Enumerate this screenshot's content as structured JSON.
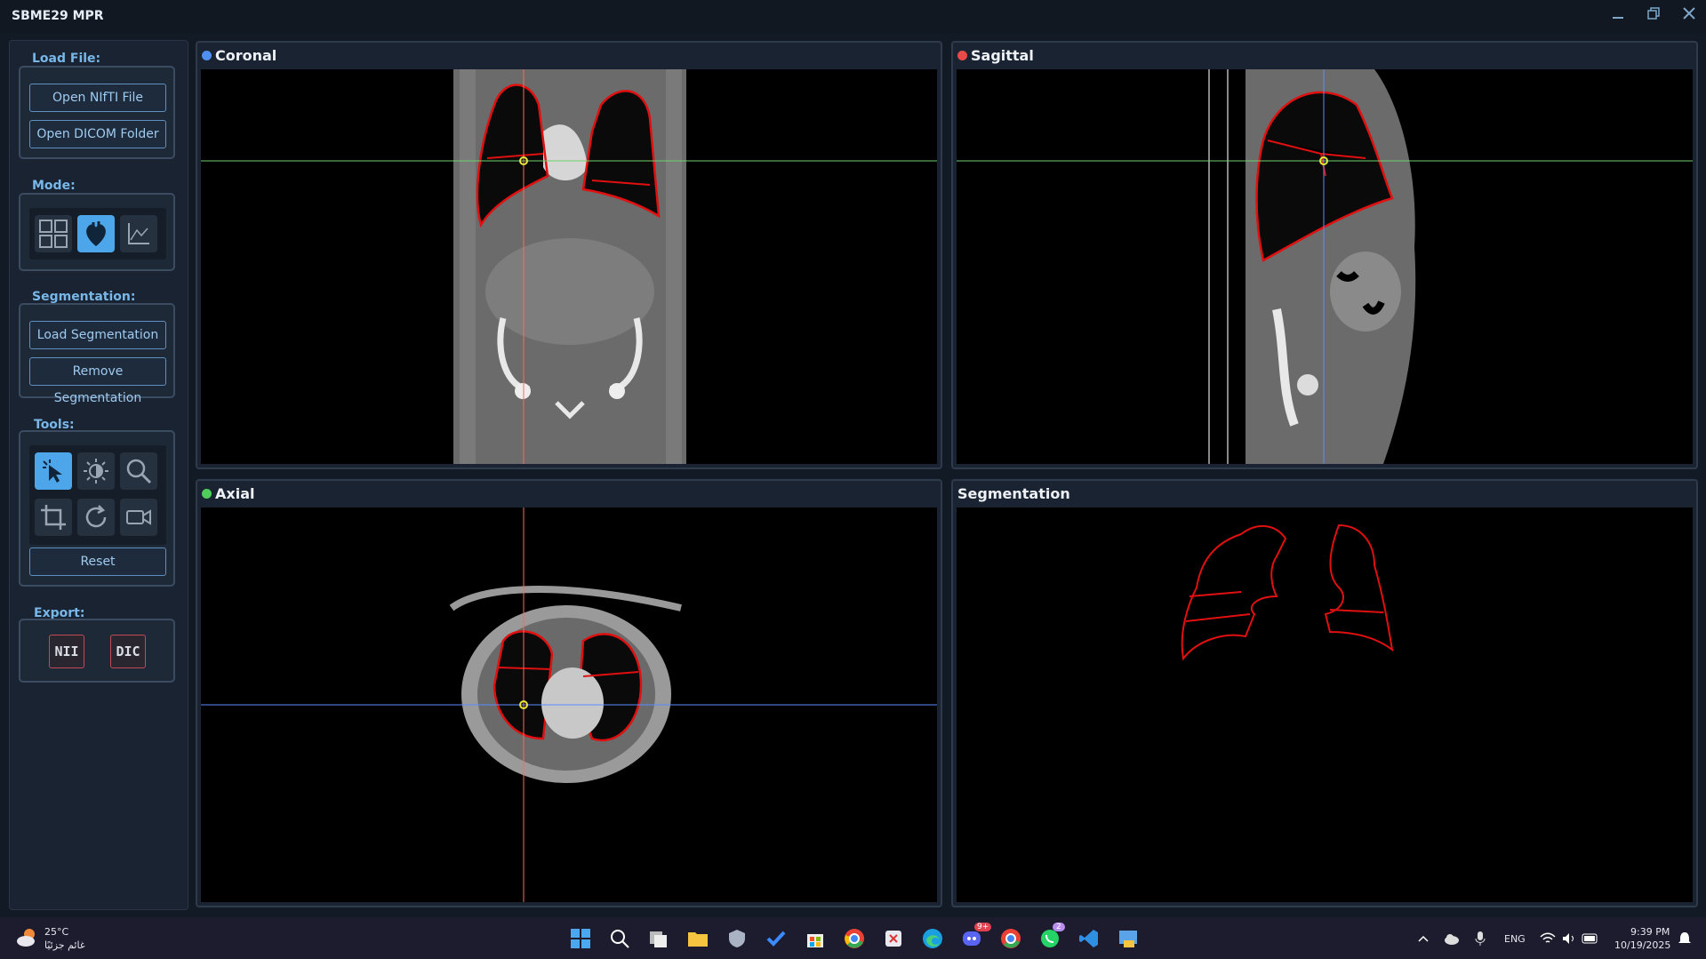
{
  "app": {
    "title": "SBME29 MPR"
  },
  "window_controls": {
    "minimize": "minimize-icon",
    "maximize": "restore-icon",
    "close": "close-icon"
  },
  "sidebar": {
    "load_file": {
      "title": "Load File:",
      "open_nifti": "Open NIfTI File",
      "open_dicom": "Open DICOM Folder"
    },
    "mode": {
      "title": "Mode:",
      "icons": [
        "grid-layout-icon",
        "heart-icon",
        "curve-chart-icon"
      ],
      "active_index": 1
    },
    "segmentation": {
      "title": "Segmentation:",
      "load": "Load Segmentation",
      "remove": "Remove Segmentation"
    },
    "tools": {
      "title": "Tools:",
      "icons": [
        "pointer-icon",
        "brightness-icon",
        "zoom-icon",
        "crop-icon",
        "rotate-icon",
        "video-camera-icon"
      ],
      "active_index": 0,
      "reset": "Reset"
    },
    "export": {
      "title": "Export:",
      "nii": "NII",
      "dic": "DIC"
    }
  },
  "views": {
    "coronal": {
      "title": "Coronal",
      "dot_color": "#4f8ff0"
    },
    "sagittal": {
      "title": "Sagittal",
      "dot_color": "#e84a4a"
    },
    "axial": {
      "title": "Axial",
      "dot_color": "#4fcf5a"
    },
    "segmentation": {
      "title": "Segmentation"
    }
  },
  "colors": {
    "accent": "#4ea6ea",
    "seg_outline": "#e01010",
    "crosshair_h": "#6fd16f",
    "crosshair_v_coronal": "#ff6a5a",
    "crosshair_v_sagittal": "#5a8cff",
    "crosshair_axial_h": "#5a8cff"
  },
  "taskbar": {
    "weather": {
      "temp": "25°C",
      "desc": "غائم جزئيًا"
    },
    "badges": {
      "discord": "9+",
      "whatsapp": "2"
    },
    "lang": "ENG",
    "time": "9:39 PM",
    "date": "10/19/2025"
  }
}
